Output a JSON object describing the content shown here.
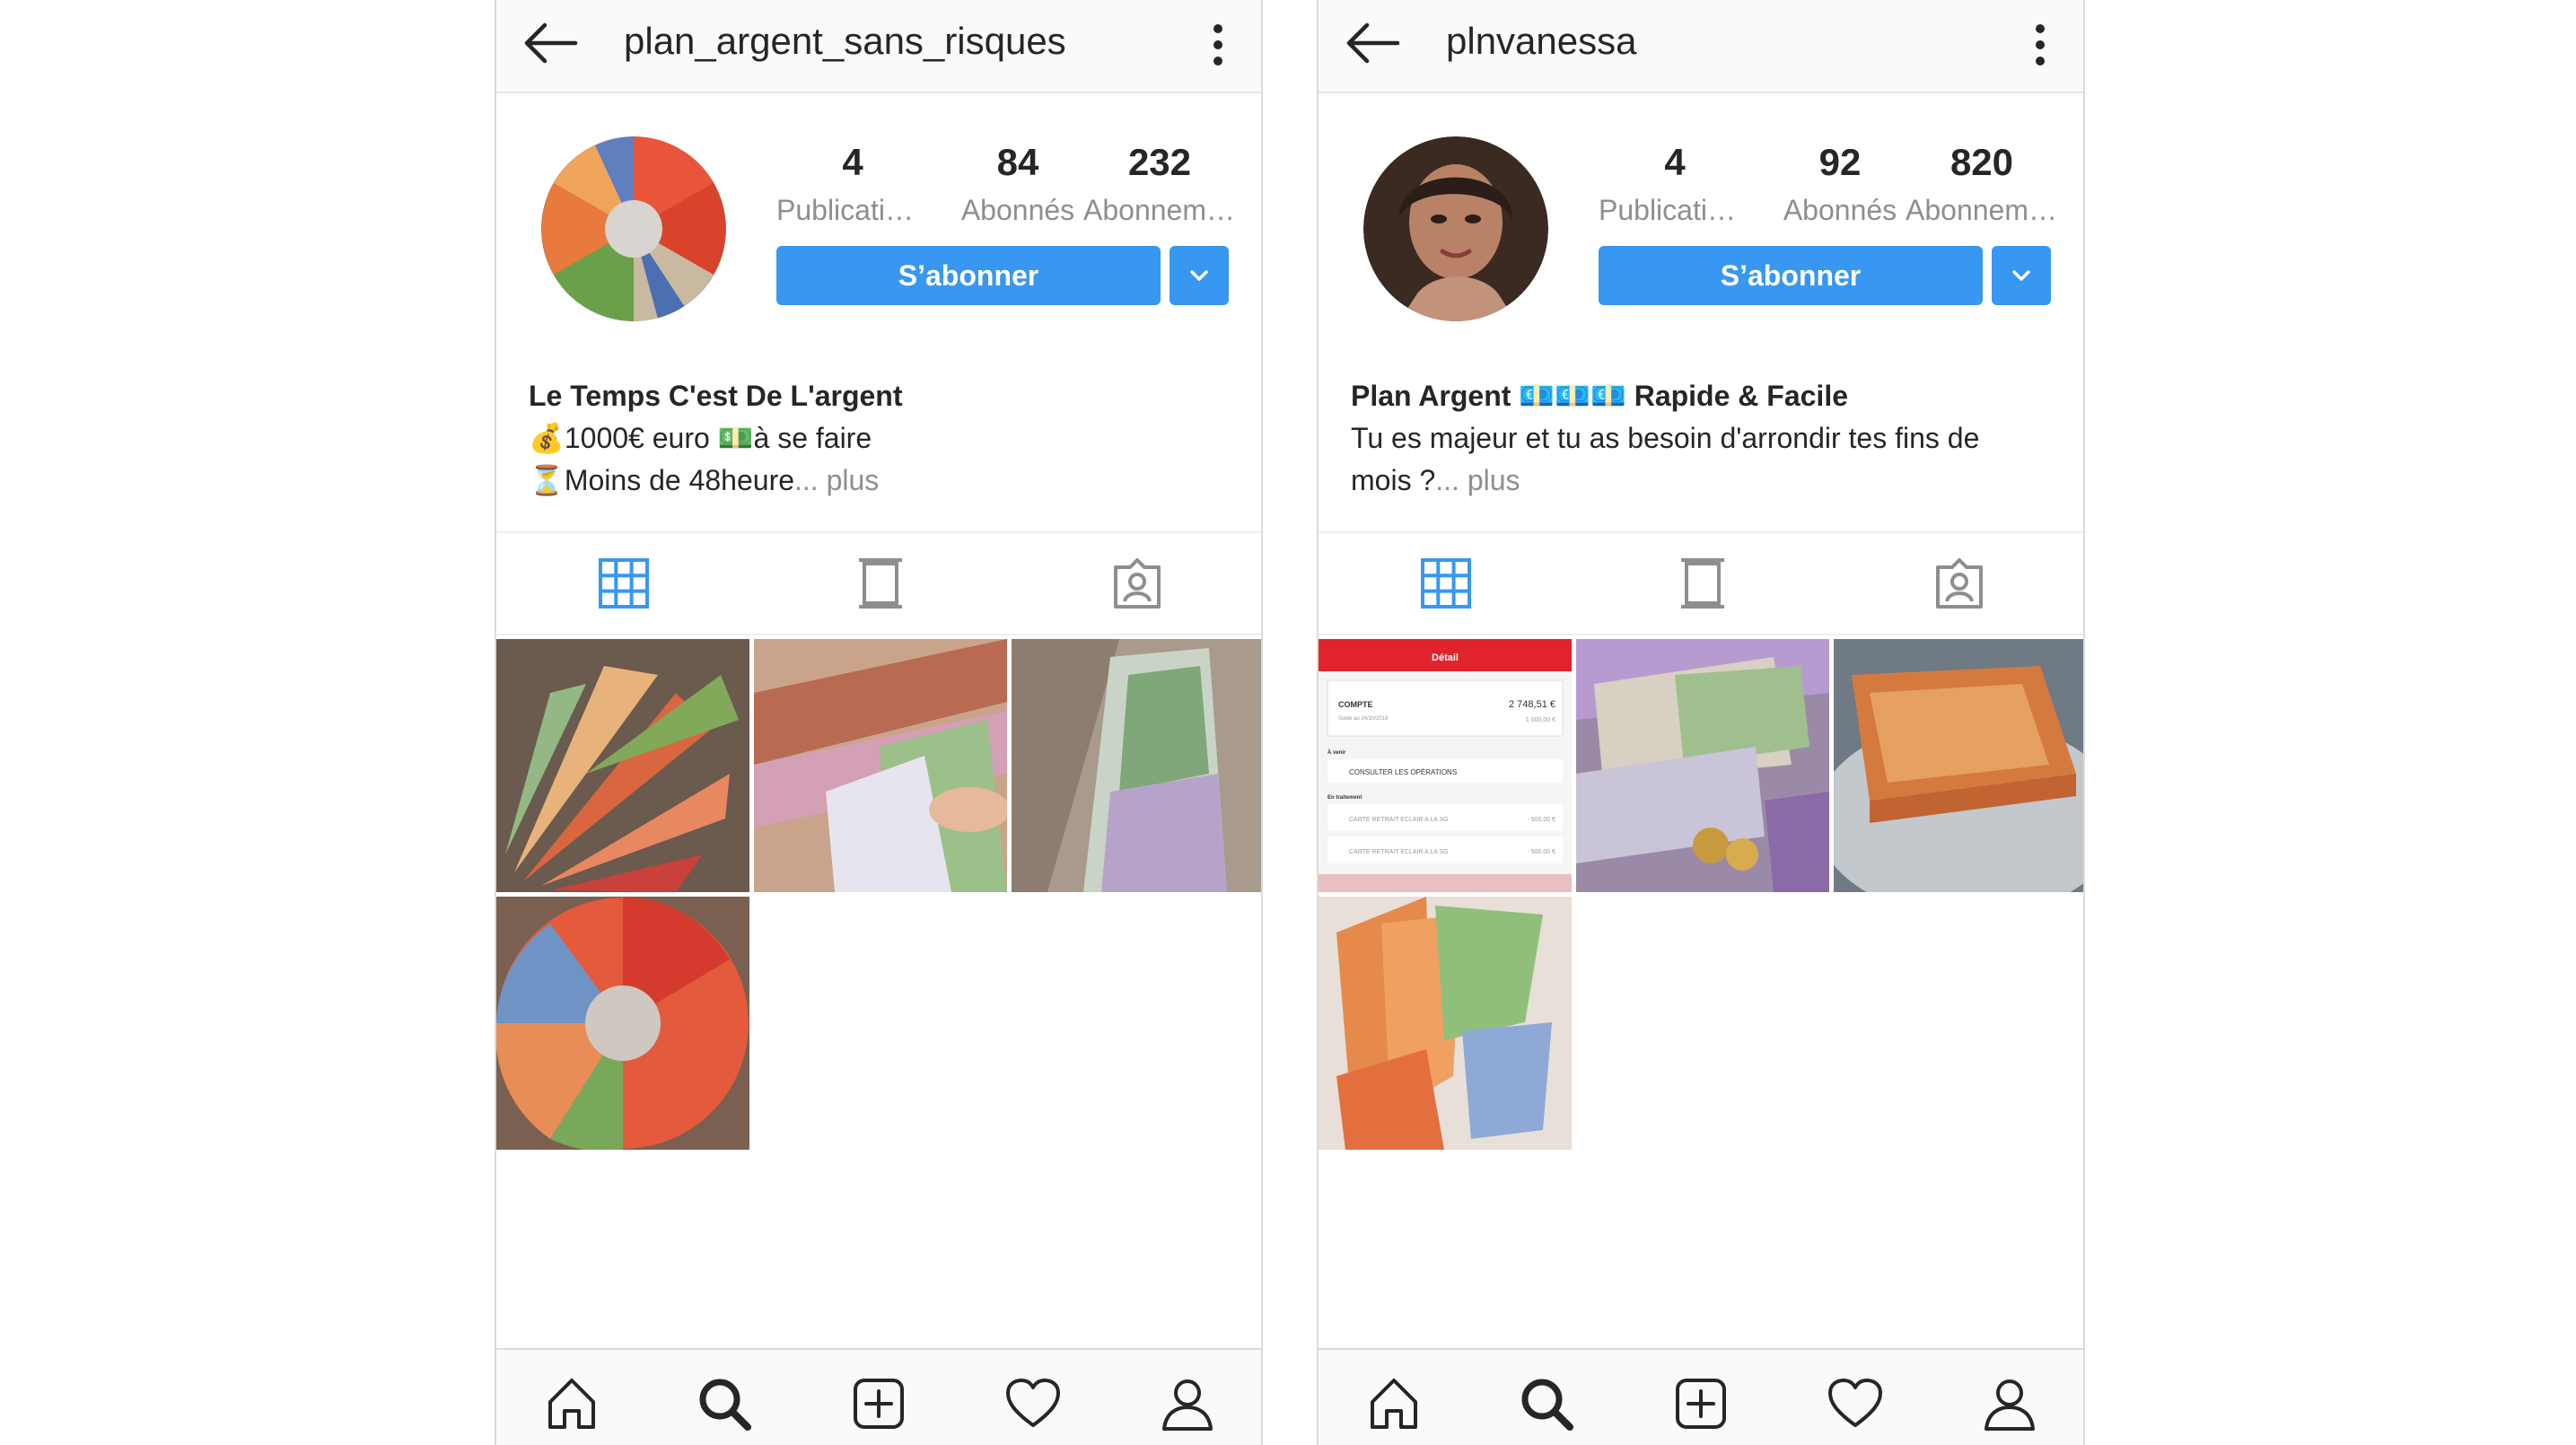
{
  "profiles": [
    {
      "username": "plan_argent_sans_risques",
      "stats": {
        "posts": {
          "count": "4",
          "label": "Publications"
        },
        "followers": {
          "count": "84",
          "label": "Abonnés"
        },
        "following": {
          "count": "232",
          "label": "Abonnements"
        }
      },
      "follow_label": "S’abonner",
      "bio": {
        "name": "Le Temps C'est De L'argent",
        "line1": "💰1000€ euro 💵à se faire",
        "line2": "⏳Moins de 48heure",
        "more": "... plus"
      },
      "thumbnail_count": 4
    },
    {
      "username": "plnvanessa",
      "stats": {
        "posts": {
          "count": "4",
          "label": "Publications"
        },
        "followers": {
          "count": "92",
          "label": "Abonnés"
        },
        "following": {
          "count": "820",
          "label": "Abonnements"
        }
      },
      "follow_label": "S’abonner",
      "bio": {
        "name": "Plan Argent 💶💶💶 Rapide & Facile",
        "line1": "Tu es majeur et tu as besoin d'arrondir tes fins de",
        "line2": "mois ?",
        "more": "... plus"
      },
      "thumbnail_count": 4,
      "bank_screenshot": {
        "header": "Détail",
        "account": "COMPTE",
        "balance": "2 748,51 €",
        "sub_balance": "1 000,00 €",
        "date": "Solde au 24/10/2019",
        "section1": "À venir",
        "consult": "CONSULTER LES OPÉRATIONS",
        "section2": "En traitement",
        "row1": "CARTE RETRAIT ECLAIR A LA SG",
        "row1_amount": "- 500,00 €",
        "row2": "CARTE RETRAIT ECLAIR A LA SG",
        "row2_amount": "- 500,00 €"
      }
    }
  ],
  "colors": {
    "accent": "#3897f0",
    "text": "#262626",
    "muted": "#8e8e8e",
    "border": "#dbdbdb"
  },
  "icons": {
    "topbar": [
      "back-arrow-icon",
      "more-vertical-icon"
    ],
    "tabs": [
      "grid-icon",
      "feed-icon",
      "tagged-icon"
    ],
    "nav": [
      "home-icon",
      "search-icon",
      "add-icon",
      "heart-icon",
      "profile-icon"
    ]
  }
}
